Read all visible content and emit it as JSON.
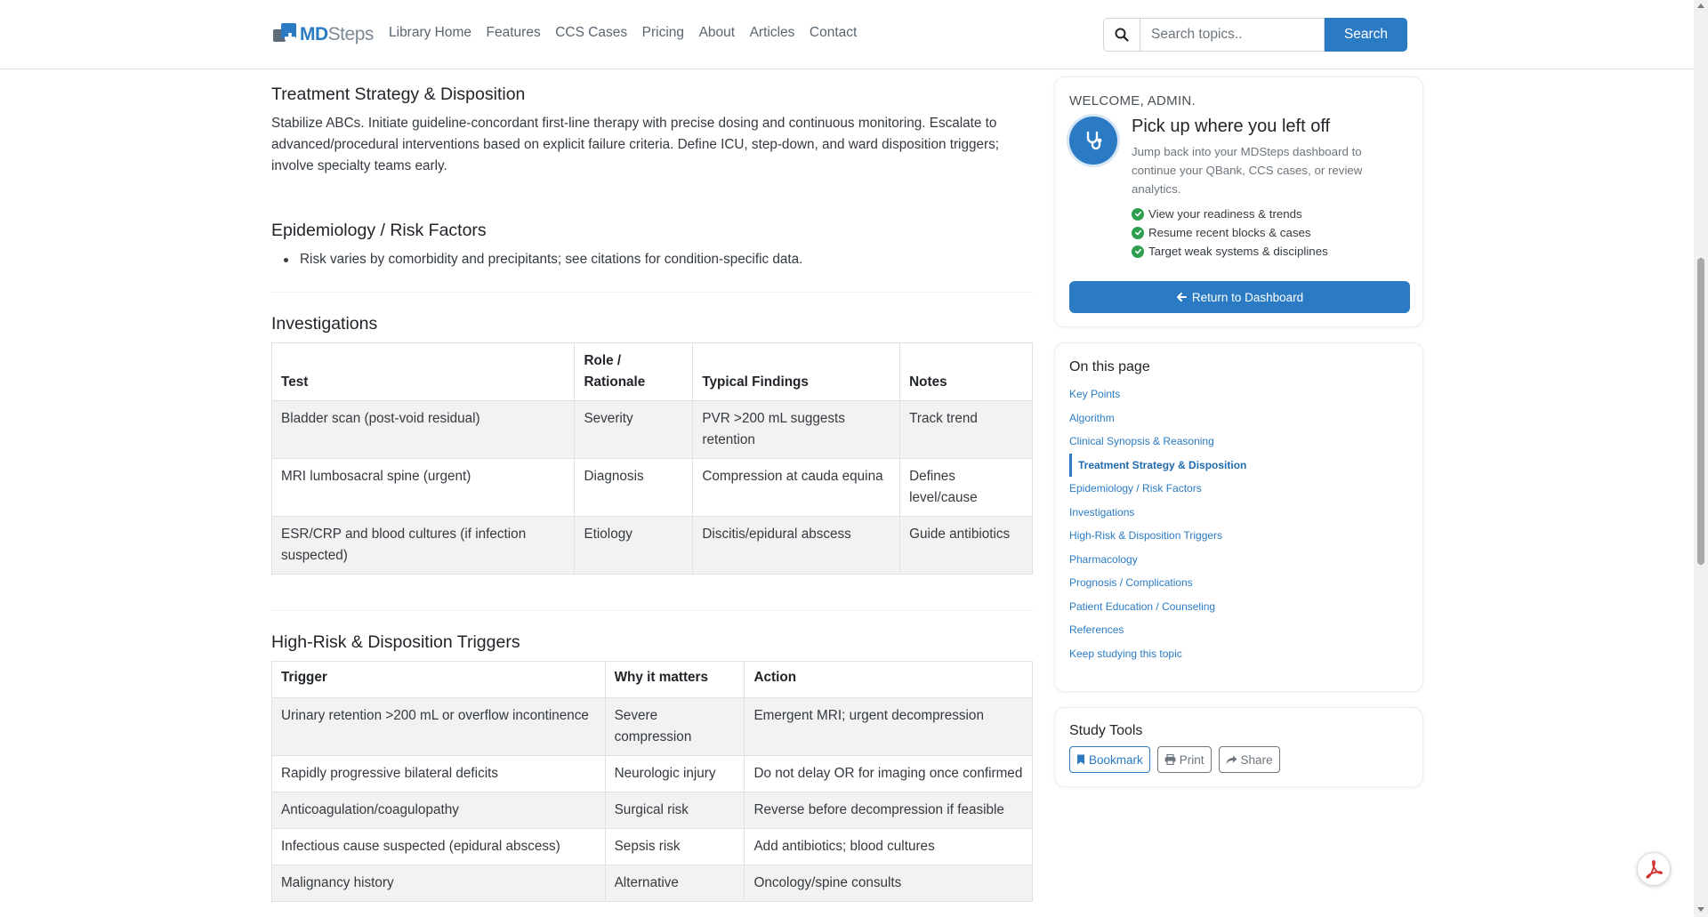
{
  "brand": {
    "logo_md": "MD",
    "logo_steps": "Steps"
  },
  "nav": {
    "links": [
      "Library Home",
      "Features",
      "CCS Cases",
      "Pricing",
      "About",
      "Articles",
      "Contact"
    ]
  },
  "search": {
    "placeholder": "Search topics..",
    "button_label": "Search"
  },
  "treatment": {
    "title": "Treatment Strategy & Disposition",
    "body": "Stabilize ABCs. Initiate guideline-concordant first-line therapy with precise dosing and continuous monitoring. Escalate to advanced/procedural interventions based on explicit failure criteria. Define ICU, step-down, and ward disposition triggers; involve specialty teams early."
  },
  "epidemiology": {
    "title": "Epidemiology / Risk Factors",
    "bullets": [
      "Risk varies by comorbidity and precipitants; see citations for condition-specific data."
    ]
  },
  "investigations": {
    "title": "Investigations",
    "headers": [
      "Test",
      "Role / Rationale",
      "Typical Findings",
      "Notes"
    ],
    "rows": [
      [
        "Bladder scan (post-void residual)",
        "Severity",
        "PVR >200 mL suggests retention",
        "Track trend"
      ],
      [
        "MRI lumbosacral spine (urgent)",
        "Diagnosis",
        "Compression at cauda equina",
        "Defines level/cause"
      ],
      [
        "ESR/CRP and blood cultures (if infection suspected)",
        "Etiology",
        "Discitis/epidural abscess",
        "Guide antibiotics"
      ]
    ]
  },
  "triggers": {
    "title": "High-Risk & Disposition Triggers",
    "headers": [
      "Trigger",
      "Why it matters",
      "Action"
    ],
    "rows": [
      [
        "Urinary retention >200 mL or overflow incontinence",
        "Severe compression",
        "Emergent MRI; urgent decompression"
      ],
      [
        "Rapidly progressive bilateral deficits",
        "Neurologic injury",
        "Do not delay OR for imaging once confirmed"
      ],
      [
        "Anticoagulation/coagulopathy",
        "Surgical risk",
        "Reverse before decompression if feasible"
      ],
      [
        "Infectious cause suspected (epidural abscess)",
        "Sepsis risk",
        "Add antibiotics; blood cultures"
      ],
      [
        "Malignancy history",
        "Alternative",
        "Oncology/spine consults"
      ]
    ]
  },
  "welcome": {
    "label": "WELCOME, ADMIN.",
    "title": "Pick up where you left off",
    "subtitle": "Jump back into your MDSteps dashboard to continue your QBank, CCS cases, or review analytics.",
    "checks": [
      "View your readiness & trends",
      "Resume recent blocks & cases",
      "Target weak systems & disciplines"
    ],
    "button_label": "Return to Dashboard"
  },
  "toc": {
    "title": "On this page",
    "items": [
      "Key Points",
      "Algorithm",
      "Clinical Synopsis & Reasoning",
      "Treatment Strategy & Disposition",
      "Epidemiology / Risk Factors",
      "Investigations",
      "High-Risk & Disposition Triggers",
      "Pharmacology",
      "Prognosis / Complications",
      "Patient Education / Counseling",
      "References",
      "Keep studying this topic"
    ],
    "active_index": 3
  },
  "study_tools": {
    "title": "Study Tools",
    "bookmark": "Bookmark",
    "print": "Print",
    "share": "Share"
  },
  "colors": {
    "brand_blue": "#2a7bc4",
    "check_green": "#2e9e4f",
    "pdf_red": "#d32f2f"
  },
  "icons": {
    "search": "search-icon",
    "stethoscope": "stethoscope-icon",
    "check": "check-circle-icon",
    "arrow_left": "arrow-left-icon",
    "bookmark": "bookmark-icon",
    "print": "printer-icon",
    "share": "share-icon",
    "pdf": "pdf-icon"
  }
}
